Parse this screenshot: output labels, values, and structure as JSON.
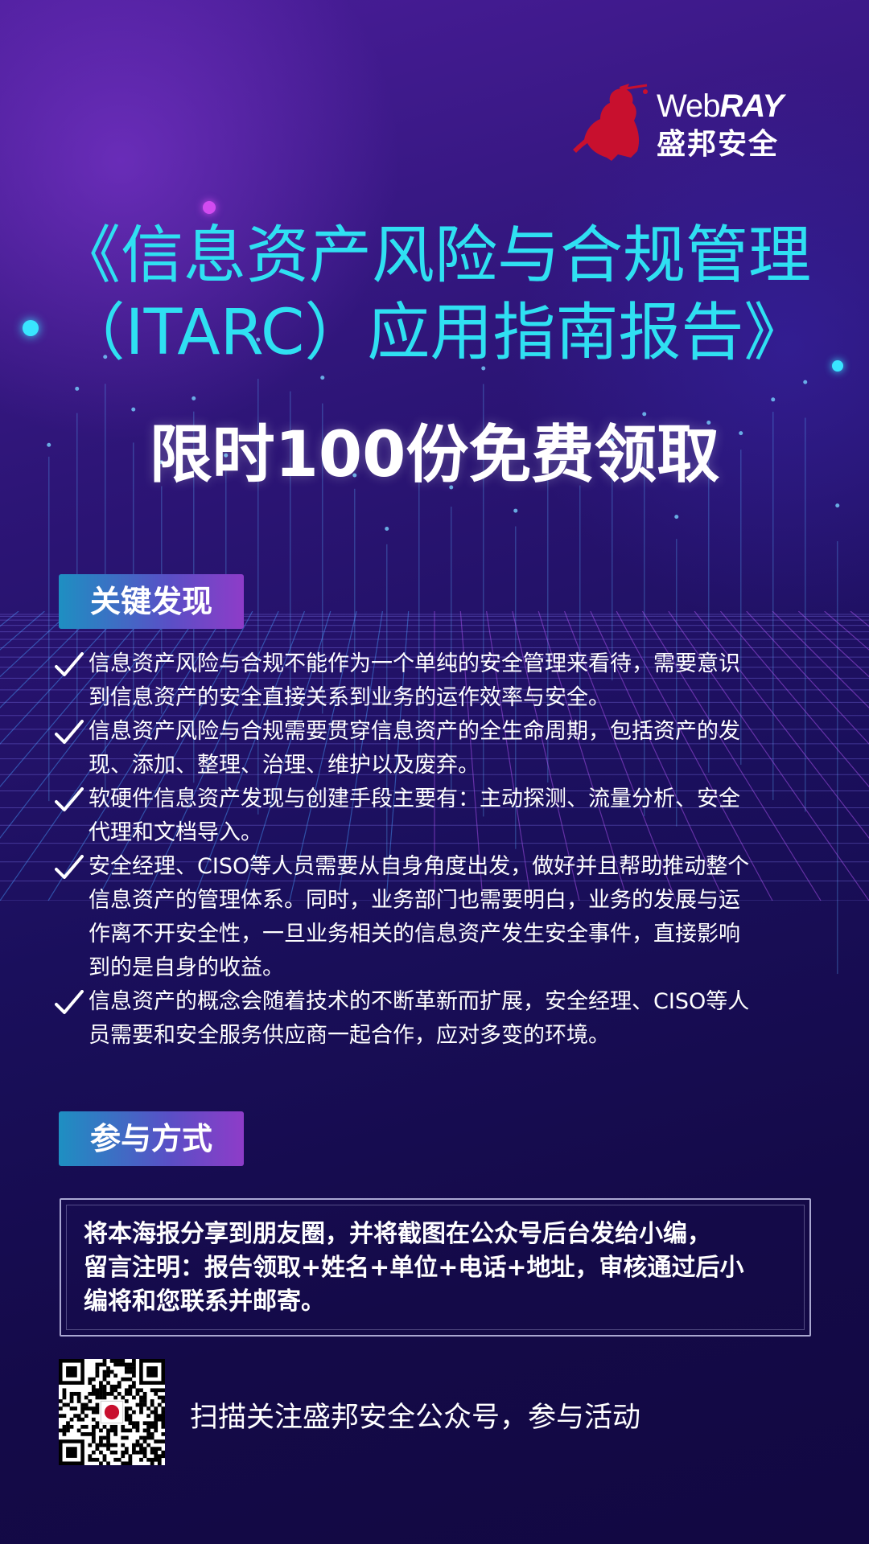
{
  "brand": {
    "en_prefix": "Web",
    "en_suffix": "RAY",
    "cn": "盛邦安全",
    "mark": "warrior-logo-icon"
  },
  "title": {
    "line1": "《信息资产风险与合规管理",
    "line2": "（ITARC）应用指南报告》"
  },
  "subtitle": "限时100份免费领取",
  "key_findings": {
    "label": "关键发现",
    "items": [
      {
        "line1": "信息资产风险与合规不能作为一个单纯的安全管理来看待，需要意识",
        "line2": "到信息资产的安全直接关系到业务的运作效率与安全。"
      },
      {
        "line1": "信息资产风险与合规需要贯穿信息资产的全生命周期，包括资产的发",
        "line2": "现、添加、整理、治理、维护以及废弃。"
      },
      {
        "line1": "软硬件信息资产发现与创建手段主要有：主动探测、流量分析、安全",
        "line2": "代理和文档导入。"
      },
      {
        "line1": "安全经理、CISO等人员需要从自身角度出发，做好并且帮助推动整个",
        "line2": "信息资产的管理体系。同时，业务部门也需要明白，业务的发展与运",
        "line3": "作离不开安全性，一旦业务相关的信息资产发生安全事件，直接影响",
        "line4": "到的是自身的收益。"
      },
      {
        "line1": "信息资产的概念会随着技术的不断革新而扩展，安全经理、CISO等人",
        "line2": "员需要和安全服务供应商一起合作，应对多变的环境。"
      }
    ]
  },
  "participation": {
    "label": "参与方式",
    "lines": [
      "将本海报分享到朋友圈，并将截图在公众号后台发给小编，",
      "留言注明：报告领取+姓名+单位+电话+地址，审核通过后小",
      "编将和您联系并邮寄。"
    ]
  },
  "qr": {
    "caption": "扫描关注盛邦安全公众号，参与活动",
    "icon": "qr-code-icon"
  },
  "colors": {
    "title": "#2fe0f2",
    "tag_gradient_start": "#1e8fc2",
    "tag_gradient_end": "#8e3cc8",
    "background_top": "#4a1d99",
    "background_bottom": "#120842",
    "logo_red": "#c8102e"
  }
}
